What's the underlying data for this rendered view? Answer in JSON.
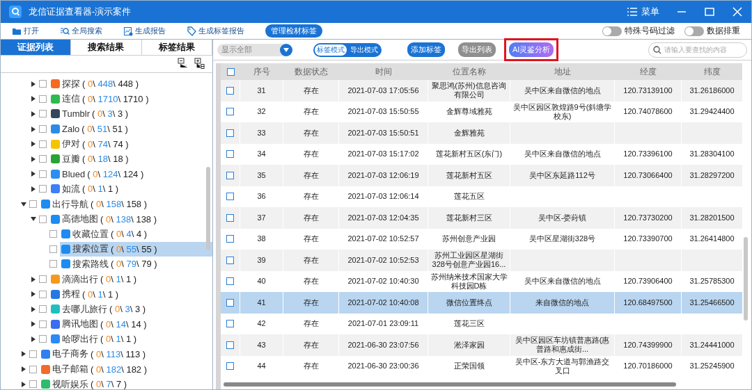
{
  "window": {
    "title": "龙信证据查看器-演示案件",
    "menu_label": "菜单"
  },
  "toolbar": [
    {
      "label": "打开",
      "kind": "folder",
      "selected": false
    },
    {
      "label": "全局搜索",
      "kind": "search",
      "selected": false
    },
    {
      "label": "生成报告",
      "kind": "report",
      "selected": false
    },
    {
      "label": "生成标签报告",
      "kind": "tag",
      "selected": false
    },
    {
      "label": "管理检材标签",
      "kind": "plain",
      "selected": true
    }
  ],
  "toggles": [
    {
      "label": "特殊号码过滤",
      "on": false
    },
    {
      "label": "数据排重",
      "on": false
    }
  ],
  "left_tabs": [
    {
      "label": "证据列表",
      "selected": true
    },
    {
      "label": "搜索结果",
      "selected": false
    },
    {
      "label": "标签结果",
      "selected": false
    }
  ],
  "count_format": {
    "open": "(",
    "sep": "\\",
    "close": ")"
  },
  "tree": [
    {
      "children": [
        {
          "label": "探探",
          "counts": [
            "0",
            "448",
            "448"
          ],
          "color": "#f36b21",
          "checked": false,
          "selected": false,
          "expanded": false
        },
        {
          "label": "连信",
          "counts": [
            "0",
            "1710",
            "1710"
          ],
          "color": "#2dbb4e",
          "checked": false,
          "selected": false,
          "expanded": false
        },
        {
          "label": "Tumblr",
          "counts": [
            "0",
            "3",
            "3"
          ],
          "color": "#35465c",
          "checked": false,
          "selected": false,
          "expanded": false
        },
        {
          "label": "Zalo",
          "counts": [
            "0",
            "51",
            "51"
          ],
          "color": "#2b8be6",
          "checked": false,
          "selected": false,
          "expanded": false
        },
        {
          "label": "伊对",
          "counts": [
            "0",
            "74",
            "74"
          ],
          "color": "#f5c400",
          "checked": false,
          "selected": false,
          "expanded": false
        },
        {
          "label": "豆瓣",
          "counts": [
            "0",
            "18",
            "18"
          ],
          "color": "#2aa336",
          "checked": false,
          "selected": false,
          "expanded": false
        },
        {
          "label": "Blued",
          "counts": [
            "0",
            "124",
            "124"
          ],
          "color": "#2a8ff0",
          "checked": false,
          "selected": false,
          "expanded": false
        },
        {
          "label": "如流",
          "counts": [
            "0",
            "1",
            "1"
          ],
          "color": "#3d7ff5",
          "checked": false,
          "selected": false,
          "expanded": false
        }
      ]
    },
    {
      "label": "出行导航",
      "counts": [
        "0",
        "158",
        "158"
      ],
      "color": "#1f8cf0",
      "checked": false,
      "selected": false,
      "expanded": true,
      "children": [
        {
          "label": "高德地图",
          "counts": [
            "0",
            "138",
            "138"
          ],
          "color": "#1c8cf2",
          "checked": false,
          "selected": false,
          "expanded": true,
          "children": [
            {
              "label": "收藏位置",
              "counts": [
                "0",
                "4",
                "4"
              ],
              "color": "#1c8cf2",
              "checked": false,
              "selected": false
            },
            {
              "label": "搜索位置",
              "counts": [
                "0",
                "55",
                "55"
              ],
              "color": "#1c8cf2",
              "checked": false,
              "selected": true
            },
            {
              "label": "搜索路线",
              "counts": [
                "0",
                "79",
                "79"
              ],
              "color": "#1c8cf2",
              "checked": false,
              "selected": false
            }
          ]
        },
        {
          "label": "滴滴出行",
          "counts": [
            "0",
            "1",
            "1"
          ],
          "color": "#f39a1e",
          "checked": false,
          "selected": false,
          "expanded": false
        },
        {
          "label": "携程",
          "counts": [
            "0",
            "1",
            "1"
          ],
          "color": "#2577e3",
          "checked": false,
          "selected": false,
          "expanded": false
        },
        {
          "label": "去哪儿旅行",
          "counts": [
            "0",
            "3",
            "3"
          ],
          "color": "#1fbfbf",
          "checked": false,
          "selected": false,
          "expanded": false
        },
        {
          "label": "腾讯地图",
          "counts": [
            "0",
            "14",
            "14"
          ],
          "color": "#3a6df0",
          "checked": false,
          "selected": false,
          "expanded": false
        },
        {
          "label": "哈啰出行",
          "counts": [
            "0",
            "1",
            "1"
          ],
          "color": "#2b8af5",
          "checked": false,
          "selected": false,
          "expanded": false
        }
      ]
    },
    {
      "label": "电子商务",
      "counts": [
        "0",
        "113",
        "113"
      ],
      "color": "#2f7ff0",
      "checked": false,
      "selected": false,
      "expanded": false
    },
    {
      "label": "电子邮箱",
      "counts": [
        "0",
        "182",
        "182"
      ],
      "color": "#f26b2a",
      "checked": false,
      "selected": false,
      "expanded": false
    },
    {
      "label": "视听娱乐",
      "counts": [
        "0",
        "7",
        "7"
      ],
      "color": "#2dbb6e",
      "checked": false,
      "selected": false,
      "expanded": false
    }
  ],
  "filter": {
    "value": "显示全部"
  },
  "mode_switch": [
    {
      "label": "标签模式",
      "selected": true
    },
    {
      "label": "导出模式",
      "selected": false
    }
  ],
  "actions": [
    {
      "label": "添加标签",
      "kind": "primary",
      "highlighted": false
    },
    {
      "label": "导出列表",
      "kind": "secondary",
      "highlighted": false
    },
    {
      "label": "AI灵鉴分析",
      "kind": "ai",
      "highlighted": true
    }
  ],
  "search": {
    "placeholder": "请输入要查找的内容"
  },
  "table": {
    "header_checked": false,
    "columns": [
      "序号",
      "数据状态",
      "时间",
      "位置名称",
      "地址",
      "经度",
      "纬度"
    ],
    "rows": [
      {
        "selected": false,
        "checked": false,
        "cells": [
          "31",
          "存在",
          "2021-07-03 17:05:56",
          "聚思鸿(苏州)信息咨询有限公司",
          "吴中区来自微信的地点",
          "120.73139100",
          "31.26186000"
        ]
      },
      {
        "selected": false,
        "checked": false,
        "cells": [
          "32",
          "存在",
          "2021-07-03 15:50:55",
          "金辉尊域雅苑",
          "吴中区园区敦煌路9号(斜塘学校东)",
          "120.74078600",
          "31.29424400"
        ]
      },
      {
        "selected": false,
        "checked": false,
        "cells": [
          "33",
          "存在",
          "2021-07-03 15:50:51",
          "金辉雅苑",
          "",
          "",
          ""
        ]
      },
      {
        "selected": false,
        "checked": false,
        "cells": [
          "34",
          "存在",
          "2021-07-03 15:17:02",
          "莲花新村五区(东门)",
          "吴中区来自微信的地点",
          "120.73396100",
          "31.28304100"
        ]
      },
      {
        "selected": false,
        "checked": false,
        "cells": [
          "35",
          "存在",
          "2021-07-03 12:06:19",
          "莲花新村五区",
          "吴中区东延路112号",
          "120.73066400",
          "31.28297200"
        ]
      },
      {
        "selected": false,
        "checked": false,
        "cells": [
          "36",
          "存在",
          "2021-07-03 12:06:14",
          "莲花五区",
          "",
          "",
          ""
        ]
      },
      {
        "selected": false,
        "checked": false,
        "cells": [
          "37",
          "存在",
          "2021-07-03 12:04:35",
          "莲花新村三区",
          "吴中区-娄葑镇",
          "120.73730200",
          "31.28201500"
        ]
      },
      {
        "selected": false,
        "checked": false,
        "cells": [
          "38",
          "存在",
          "2021-07-02 10:52:57",
          "苏州创意产业园",
          "吴中区星湖街328号",
          "120.73390700",
          "31.26414800"
        ]
      },
      {
        "selected": false,
        "checked": false,
        "cells": [
          "39",
          "存在",
          "2021-07-02 10:52:53",
          "苏州工业园区星湖街328号创意产业园16...",
          "",
          "",
          ""
        ]
      },
      {
        "selected": false,
        "checked": false,
        "cells": [
          "40",
          "存在",
          "2021-07-02 10:40:30",
          "苏州纳米技术国家大学科技园D栋",
          "吴中区来自微信的地点",
          "120.73906400",
          "31.25785300"
        ]
      },
      {
        "selected": true,
        "checked": false,
        "cells": [
          "41",
          "存在",
          "2021-07-02 10:40:08",
          "微信位置终点",
          "来自微信的地点",
          "120.68497500",
          "31.25466500"
        ]
      },
      {
        "selected": false,
        "checked": false,
        "cells": [
          "42",
          "存在",
          "2021-07-01 23:09:11",
          "莲花三区",
          "",
          "",
          ""
        ]
      },
      {
        "selected": false,
        "checked": false,
        "cells": [
          "43",
          "存在",
          "2021-06-30 23:07:56",
          "淞泽家园",
          "吴中区园区车坊镇普惠路(惠普路和惠成街...",
          "120.74399900",
          "31.24441000"
        ]
      },
      {
        "selected": false,
        "checked": false,
        "cells": [
          "44",
          "存在",
          "2021-06-30 23:00:36",
          "正荣国领",
          "吴中区-东方大道与郭渔路交叉口",
          "120.70186000",
          "31.25245900"
        ]
      }
    ]
  }
}
